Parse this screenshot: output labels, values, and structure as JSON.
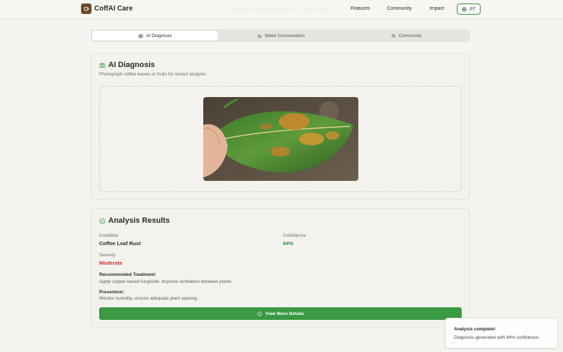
{
  "header": {
    "brand": "CoffAI Care",
    "ghost_title": "Test the main features of CoffAI Care",
    "nav": [
      "Features",
      "Community",
      "Impact"
    ],
    "lang_label": "PT"
  },
  "tabs": [
    {
      "label": "AI Diagnosis",
      "icon": "camera-icon",
      "active": true
    },
    {
      "label": "Water Conservation",
      "icon": "droplets-icon",
      "active": false
    },
    {
      "label": "Community",
      "icon": "users-icon",
      "active": false
    }
  ],
  "diagnosis": {
    "title": "AI Diagnosis",
    "subtitle": "Photograph coffee leaves or fruits for instant analysis"
  },
  "results": {
    "title": "Analysis Results",
    "condition_label": "Condition",
    "condition_value": "Coffee Leaf Rust",
    "confidence_label": "Confidence",
    "confidence_value": "94%",
    "severity_label": "Severity",
    "severity_value": "Moderate",
    "treatment_title": "Recommended Treatment:",
    "treatment_text": "Apply copper-based fungicide. Improve ventilation between plants.",
    "prevention_title": "Prevention:",
    "prevention_text": "Monitor humidity, ensure adequate plant spacing.",
    "button_label": "View More Details"
  },
  "toast": {
    "title": "Analysis complete!",
    "text": "Diagnosis generated with 94% confidence."
  },
  "colors": {
    "accent_green": "#3a9943",
    "confidence_green": "#3a8f43",
    "severity_red": "#c0392b",
    "brand_brown": "#6b4a2b"
  }
}
